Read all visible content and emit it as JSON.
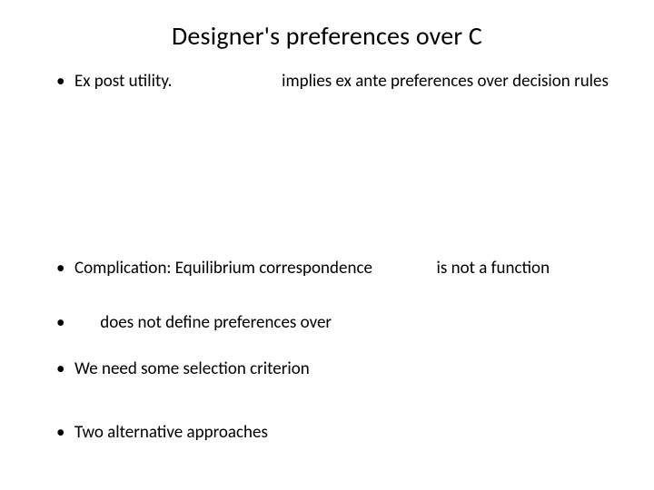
{
  "title": "Designer's preferences over C",
  "bullets": {
    "b1a": "Ex post utility.",
    "b1b": "implies ex ante preferences over decision rules",
    "b2a": "Complication: Equilibrium correspondence",
    "b2b": "is not a function",
    "b3": "does not define preferences over",
    "b4": "We need some selection criterion",
    "b5": "Two alternative approaches"
  }
}
